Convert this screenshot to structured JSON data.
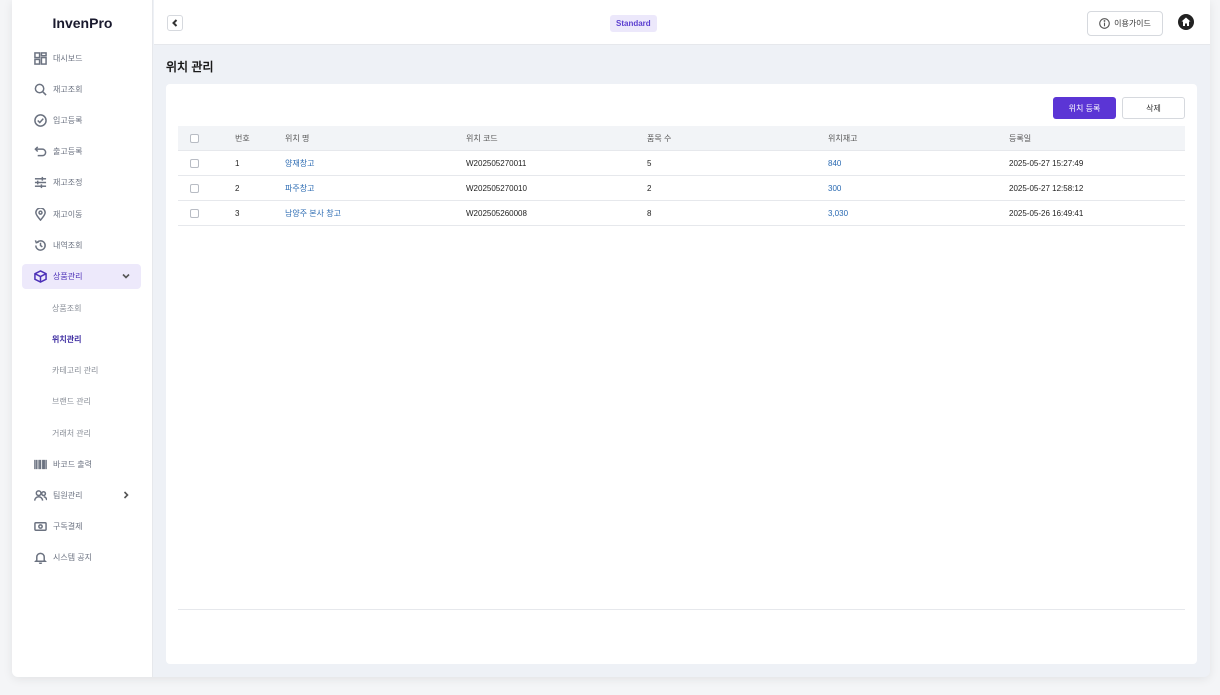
{
  "app": {
    "logo": "InvenPro"
  },
  "sidebar": {
    "items": [
      {
        "label": "대시보드",
        "icon": "dashboard-icon"
      },
      {
        "label": "재고조회",
        "icon": "search-icon"
      },
      {
        "label": "입고등록",
        "icon": "check-circle-icon"
      },
      {
        "label": "출고등록",
        "icon": "undo-icon"
      },
      {
        "label": "재고조정",
        "icon": "sliders-icon"
      },
      {
        "label": "재고이동",
        "icon": "location-pin-icon"
      },
      {
        "label": "내역조회",
        "icon": "history-icon"
      },
      {
        "label": "상품관리",
        "icon": "box-icon"
      },
      {
        "label": "바코드 출력",
        "icon": "barcode-icon"
      },
      {
        "label": "팀원관리",
        "icon": "users-icon"
      },
      {
        "label": "구독결제",
        "icon": "payment-icon"
      },
      {
        "label": "시스템 공지",
        "icon": "bell-icon"
      }
    ],
    "sub_items": [
      {
        "label": "상품조회"
      },
      {
        "label": "위치관리"
      },
      {
        "label": "카테고리 관리"
      },
      {
        "label": "브랜드 관리"
      },
      {
        "label": "거래처 관리"
      }
    ]
  },
  "header": {
    "plan_badge": "Standard",
    "guide_label": "이용가이드"
  },
  "main": {
    "title": "위치 관리",
    "register_label": "위치 등록",
    "delete_label": "삭제",
    "columns": [
      "번호",
      "위치 명",
      "위치 코드",
      "품목 수",
      "위치재고",
      "등록일"
    ],
    "rows": [
      {
        "no": "1",
        "name": "양재창고",
        "code": "W202505270011",
        "items": "5",
        "stock": "840",
        "date": "2025-05-27 15:27:49"
      },
      {
        "no": "2",
        "name": "파주창고",
        "code": "W202505270010",
        "items": "2",
        "stock": "300",
        "date": "2025-05-27 12:58:12"
      },
      {
        "no": "3",
        "name": "남양주 본사 창고",
        "code": "W202505260008",
        "items": "8",
        "stock": "3,030",
        "date": "2025-05-26 16:49:41"
      }
    ]
  },
  "colors": {
    "accent": "#5b35d5",
    "link": "#2a6ab2",
    "active_bg": "#ede9fb"
  }
}
